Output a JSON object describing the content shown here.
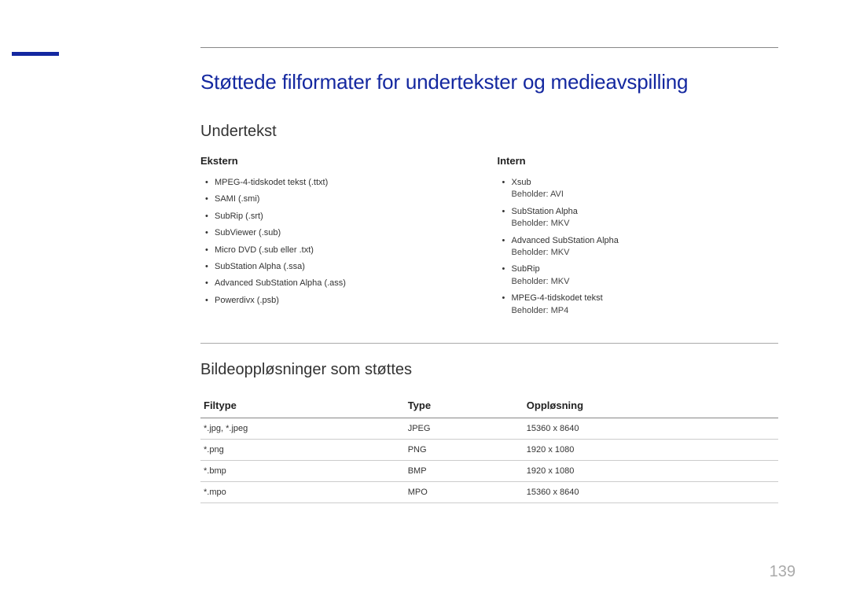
{
  "title": "Støttede filformater for undertekster og medieavspilling",
  "section1": {
    "heading": "Undertekst",
    "col1": {
      "heading": "Ekstern",
      "items": [
        {
          "text": "MPEG-4-tidskodet tekst (.ttxt)"
        },
        {
          "text": "SAMI (.smi)"
        },
        {
          "text": "SubRip (.srt)"
        },
        {
          "text": "SubViewer (.sub)"
        },
        {
          "text": "Micro DVD (.sub eller .txt)"
        },
        {
          "text": "SubStation Alpha (.ssa)"
        },
        {
          "text": "Advanced SubStation Alpha (.ass)"
        },
        {
          "text": "Powerdivx (.psb)"
        }
      ]
    },
    "col2": {
      "heading": "Intern",
      "items": [
        {
          "text": "Xsub",
          "sub": "Beholder: AVI"
        },
        {
          "text": "SubStation Alpha",
          "sub": "Beholder: MKV"
        },
        {
          "text": "Advanced SubStation Alpha",
          "sub": "Beholder: MKV"
        },
        {
          "text": "SubRip",
          "sub": "Beholder: MKV"
        },
        {
          "text": "MPEG-4-tidskodet tekst",
          "sub": "Beholder: MP4"
        }
      ]
    }
  },
  "section2": {
    "heading": "Bildeoppløsninger som støttes",
    "headers": [
      "Filtype",
      "Type",
      "Oppløsning"
    ],
    "rows": [
      [
        "*.jpg, *.jpeg",
        "JPEG",
        "15360 x 8640"
      ],
      [
        "*.png",
        "PNG",
        "1920 x 1080"
      ],
      [
        "*.bmp",
        "BMP",
        "1920 x 1080"
      ],
      [
        "*.mpo",
        "MPO",
        "15360 x 8640"
      ]
    ]
  },
  "page_number": "139"
}
